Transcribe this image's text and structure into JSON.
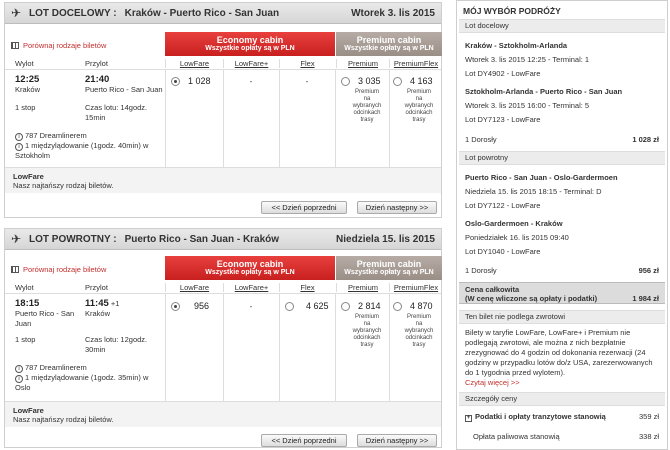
{
  "outbound": {
    "plane_icon": "plane-icon",
    "direction": "LOT DOCELOWY :",
    "route": "Kraków - Puerto Rico - San Juan",
    "date": "Wtorek 3. lis 2015",
    "compare": "Porównaj rodzaje biletów",
    "economy_title": "Economy cabin",
    "economy_sub": "Wszystkie opłaty są w PLN",
    "premium_title": "Premium cabin",
    "premium_sub": "Wszystkie opłaty są w PLN",
    "col_lowfare": "LowFare",
    "col_lowfare_plus": "LowFare+",
    "col_flex": "Flex",
    "col_premium": "Premium",
    "col_premiumflex": "PremiumFlex",
    "label_dep": "Wylot",
    "label_arr": "Przylot",
    "dep_time": "12:25",
    "dep_city": "Kraków",
    "arr_time": "21:40",
    "arr_city": "Puerto Rico - San Juan",
    "stops": "1 stop",
    "duration": "Czas lotu: 14godz. 15min",
    "aircraft": "787 Dreamlinerem",
    "layover": "1 międzylądowanie (1godz. 40min) w Sztokholm",
    "price_lowfare": "1 028",
    "price_lowfare_plus": "-",
    "price_flex": "-",
    "price_premium": "3 035",
    "price_premiumflex": "4 163",
    "premium_note": "Premium na wybranych odcinkach trasy",
    "premiumflex_note": "Premium na wybranych odcinkach trasy",
    "fare_name": "LowFare",
    "fare_desc": "Nasz najtańszy rodzaj biletów.",
    "prev_day": "<< Dzień poprzedni",
    "next_day": "Dzień następny >>"
  },
  "return": {
    "direction": "LOT POWROTNY :",
    "route": "Puerto Rico - San Juan - Kraków",
    "date": "Niedziela 15. lis 2015",
    "compare": "Porównaj rodzaje biletów",
    "economy_title": "Economy cabin",
    "economy_sub": "Wszystkie opłaty są w PLN",
    "premium_title": "Premium cabin",
    "premium_sub": "Wszystkie opłaty są w PLN",
    "col_lowfare": "LowFare",
    "col_lowfare_plus": "LowFare+",
    "col_flex": "Flex",
    "col_premium": "Premium",
    "col_premiumflex": "PremiumFlex",
    "label_dep": "Wylot",
    "label_arr": "Przylot",
    "dep_time": "18:15",
    "dep_city": "Puerto Rico - San Juan",
    "arr_time": "11:45",
    "arr_plus": "+1",
    "arr_city": "Kraków",
    "stops": "1 stop",
    "duration": "Czas lotu: 12godz. 30min",
    "aircraft": "787 Dreamlinerem",
    "layover": "1 międzylądowanie (1godz. 35min) w Oslo",
    "price_lowfare": "956",
    "price_lowfare_plus": "-",
    "price_flex": "4 625",
    "price_premium": "2 814",
    "price_premiumflex": "4 870",
    "premium_note": "Premium na wybranych odcinkach trasy",
    "premiumflex_note": "Premium na wybranych odcinkach trasy",
    "fare_name": "LowFare",
    "fare_desc": "Nasz najtańszy rodzaj biletów.",
    "prev_day": "<< Dzień poprzedni",
    "next_day": "Dzień następny >>"
  },
  "summary": {
    "title": "MÓJ WYBÓR PODRÓŻY",
    "outbound_section": "Lot docelowy",
    "seg1_route": "Kraków - Sztokholm-Arlanda",
    "seg1_time": "Wtorek 3. lis 2015 12:25 - Terminal: 1",
    "seg1_flight": "Lot DY4902 - LowFare",
    "seg2_route": "Sztokholm-Arlanda - Puerto Rico - San Juan",
    "seg2_time": "Wtorek 3. lis 2015 16:00 - Terminal: 5",
    "seg2_flight": "Lot DY7123 - LowFare",
    "outbound_pax": "1 Dorosły",
    "outbound_price": "1 028 zł",
    "return_section": "Lot powrotny",
    "seg3_route": "Puerto Rico - San Juan - Oslo-Gardermoen",
    "seg3_time": "Niedziela 15. lis 2015 18:15 - Terminal: D",
    "seg3_flight": "Lot DY7122 - LowFare",
    "seg4_route": "Oslo-Gardermoen - Kraków",
    "seg4_time": "Poniedziałek 16. lis 2015 09:40",
    "seg4_flight": "Lot DY1040 - LowFare",
    "return_pax": "1 Dorosły",
    "return_price": "956 zł",
    "total_label": "Cena całkowita",
    "total_sub": "(W cenę wliczone są opłaty i podatki)",
    "total_price": "1 984 zł",
    "refund_section": "Ten bilet nie podlega zwrotowi",
    "refund_text": "Bilety w taryfie LowFare, LowFare+ i Premium nie podlegają zwrotowi, ale można z nich bezpłatnie zrezygnować do 4 godzin od dokonania rezerwacji (24 godziny w przypadku lotów do/z USA, zarezerwowanych do 1 tygodnia przed wylotem).",
    "read_more": "Czytaj więcej >>",
    "details_section": "Szczegóły ceny",
    "taxes_label": "Podatki i opłaty tranzytowe stanowią",
    "taxes_price": "359 zł",
    "fuel_label": "Opłata paliwowa stanowią",
    "fuel_price": "338 zł"
  },
  "colors": {
    "economy": "#d42a28",
    "premium": "#a89d95",
    "link": "#c0302f"
  }
}
